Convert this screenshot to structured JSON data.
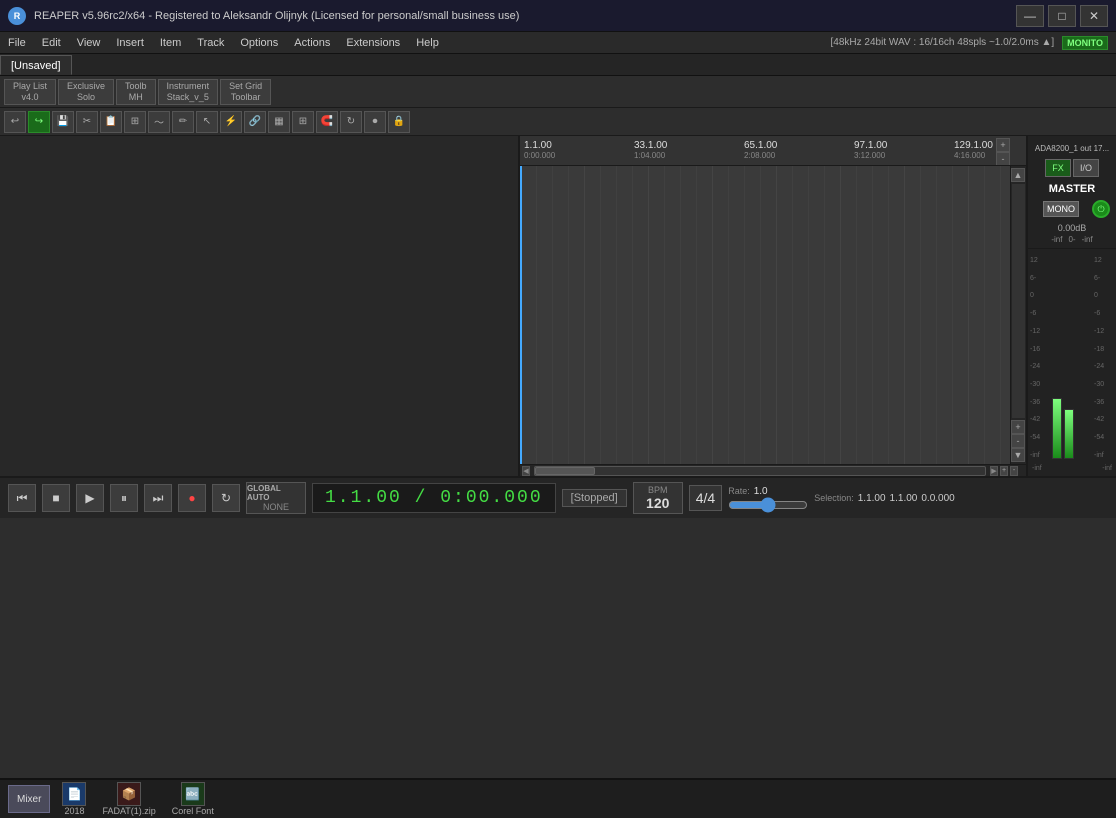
{
  "titlebar": {
    "title": "REAPER v5.96rc2/x64 - Registered to Aleksandr Olijnyk (Licensed for personal/small business use)",
    "status_right": "[48kHz 24bit WAV : 16/16ch 48spls ~1.0/2.0ms ▲]",
    "monitor": "MONITO",
    "minimize": "—",
    "maximize": "□",
    "close": "✕"
  },
  "menubar": {
    "items": [
      "File",
      "Edit",
      "View",
      "Insert",
      "Item",
      "Track",
      "Options",
      "Actions",
      "Extensions",
      "Help"
    ]
  },
  "tabs": [
    {
      "label": "[Unsaved]",
      "active": true
    }
  ],
  "toolbar1": {
    "btn_playlist": "Play List\nv4.0",
    "btn_excl_solo": "Exclusive\nSolo",
    "btn_toolb_mh": "Toolb\nMH",
    "btn_inst_stack": "Instrument\nStack_v_5",
    "btn_set_grid": "Set Grid\nToolbar"
  },
  "toolbar2": {
    "icons": [
      "undo-icon",
      "redo-icon",
      "cut-icon",
      "copy-icon",
      "paste-icon",
      "delete-icon",
      "envelope-icon",
      "pencil-icon",
      "select-icon",
      "split-icon",
      "glue-icon",
      "loop-icon",
      "grid-icon",
      "snap-icon",
      "zoom-icon",
      "record-mode-icon",
      "lock-icon"
    ]
  },
  "timeline": {
    "markers": [
      {
        "bar": "1.1.00",
        "time": "0:00.000",
        "pos": 0
      },
      {
        "bar": "33.1.00",
        "time": "1:04.000",
        "pos": 130
      },
      {
        "bar": "65.1.00",
        "time": "2:08.000",
        "pos": 240
      },
      {
        "bar": "97.1.00",
        "time": "3:12.000",
        "pos": 350
      },
      {
        "bar": "129.1.00",
        "time": "4:16.000",
        "pos": 450
      }
    ]
  },
  "transport": {
    "time_display": "1.1.00 / 0:00.000",
    "status": "[Stopped]",
    "bpm_label": "BPM",
    "bpm_value": "120",
    "timesig": "4/4",
    "rate_label": "Rate:",
    "rate_value": "1.0",
    "selection_label": "Selection:",
    "selection_start": "1.1.00",
    "selection_end": "1.1.00",
    "selection_len": "0.0.000",
    "global_auto_top": "GLOBAL AUTO",
    "global_auto_bot": "NONE",
    "btn_goto_start": "⏮",
    "btn_stop": "■",
    "btn_play": "▶",
    "btn_pause": "⏸",
    "btn_goto_end": "⏭",
    "btn_record": "●",
    "btn_loop": "↻"
  },
  "right_panel": {
    "ada_label": "ADA8200_1 out 17...",
    "fx_label": "FX",
    "io_label": "I/O",
    "master_label": "MASTER",
    "mono_label": "MONO",
    "db_label": "0.00dB",
    "meter_scales": [
      "-inf",
      "0-",
      "-6",
      "-12",
      "-18",
      "-24",
      "-30",
      "-36",
      "-42",
      "-54",
      "-inf"
    ],
    "meter_scales_right": [
      "-inf",
      "0-",
      "-6",
      "-12",
      "-18",
      "-24",
      "-30",
      "-36",
      "-42",
      "-54",
      "-inf"
    ]
  },
  "taskbar": {
    "mixer_label": "Mixer",
    "item1_label": "2018",
    "item2_label": "FADAT(1).zip",
    "item3_label": "Corel Font"
  }
}
